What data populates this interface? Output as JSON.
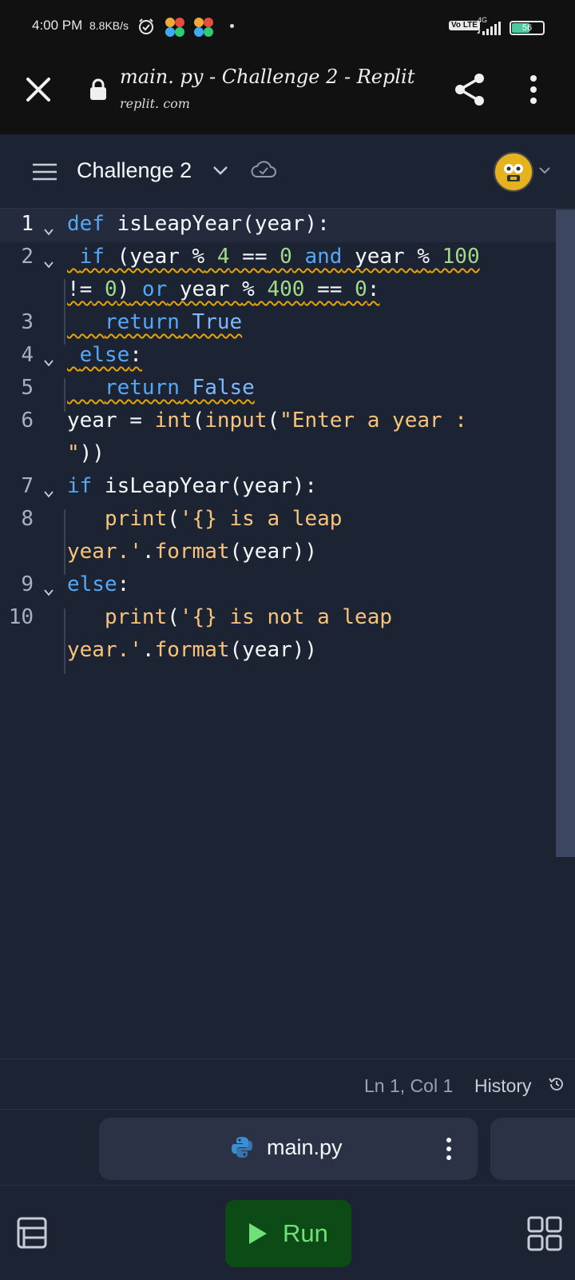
{
  "status_bar": {
    "time": "4:00 PM",
    "speed": "8.8KB/s",
    "volte": "Vo LTE",
    "network": "4G",
    "battery": "56"
  },
  "browser": {
    "title": "main. py - Challenge 2 - Replit",
    "domain": "replit. com"
  },
  "header": {
    "project_name": "Challenge 2"
  },
  "editor": {
    "line_numbers": [
      "1",
      "2",
      "3",
      "4",
      "5",
      "6",
      "7",
      "8",
      "9",
      "10"
    ],
    "line1": {
      "kw": "def",
      "name": " isLeapYear",
      "rest": "(year):"
    },
    "line2a": {
      "kw_if": "if",
      "p1": " (year ",
      "op1": "%",
      "n4": " 4",
      "eq": " ==",
      "n0": " 0",
      "and": " and",
      "p2": " year ",
      "op2": "%",
      "n100": " 100"
    },
    "line2b": {
      "neq": "!=",
      "n0": " 0",
      "close": ")",
      "or": " or",
      "p3": " year ",
      "op3": "%",
      "n400": " 400",
      "eq2": " ==",
      "n0b": " 0",
      "colon": ":"
    },
    "line3": {
      "kw": "return",
      "val": " True"
    },
    "line4": {
      "kw": "else",
      "colon": ":"
    },
    "line5": {
      "kw": "return",
      "val": " False"
    },
    "line6a": {
      "a": "year ",
      "eq": "=",
      "b": " int",
      "c": "(",
      "d": "input",
      "e": "(",
      "str": "\"Enter a year :"
    },
    "line6b": {
      "str": "\"",
      "close": "))"
    },
    "line7": {
      "kw": "if",
      "name": " isLeapYear",
      "rest": "(year):"
    },
    "line8a": {
      "fn": "print",
      "p": "(",
      "str": "'{} is a leap"
    },
    "line8b": {
      "str": "year.'",
      "rest1": ".",
      "fn": "format",
      "rest2": "(year))"
    },
    "line9": {
      "kw": "else",
      "colon": ":"
    },
    "line10a": {
      "fn": "print",
      "p": "(",
      "str": "'{} is not a leap"
    },
    "line10b": {
      "str": "year.'",
      "rest1": ".",
      "fn": "format",
      "rest2": "(year))"
    }
  },
  "statusline": {
    "position": "Ln 1, Col 1",
    "history": "History"
  },
  "tabs": {
    "file_name": "main.py"
  },
  "bottom": {
    "run_label": "Run"
  },
  "colors": {
    "background": "#1c2333",
    "keyword": "#56a8f5",
    "number": "#a3d98a",
    "string": "#f8c37a",
    "run_button": "#0c4b16",
    "run_text": "#6fe07a"
  },
  "icons": [
    "alarm-icon",
    "close-icon",
    "lock-icon",
    "share-icon",
    "more-vert-icon",
    "menu-icon",
    "chevron-down-icon",
    "cloud-check-icon",
    "avatar",
    "history-icon",
    "python-icon",
    "kebab-icon",
    "layout-icon",
    "play-icon",
    "grid-icon"
  ]
}
